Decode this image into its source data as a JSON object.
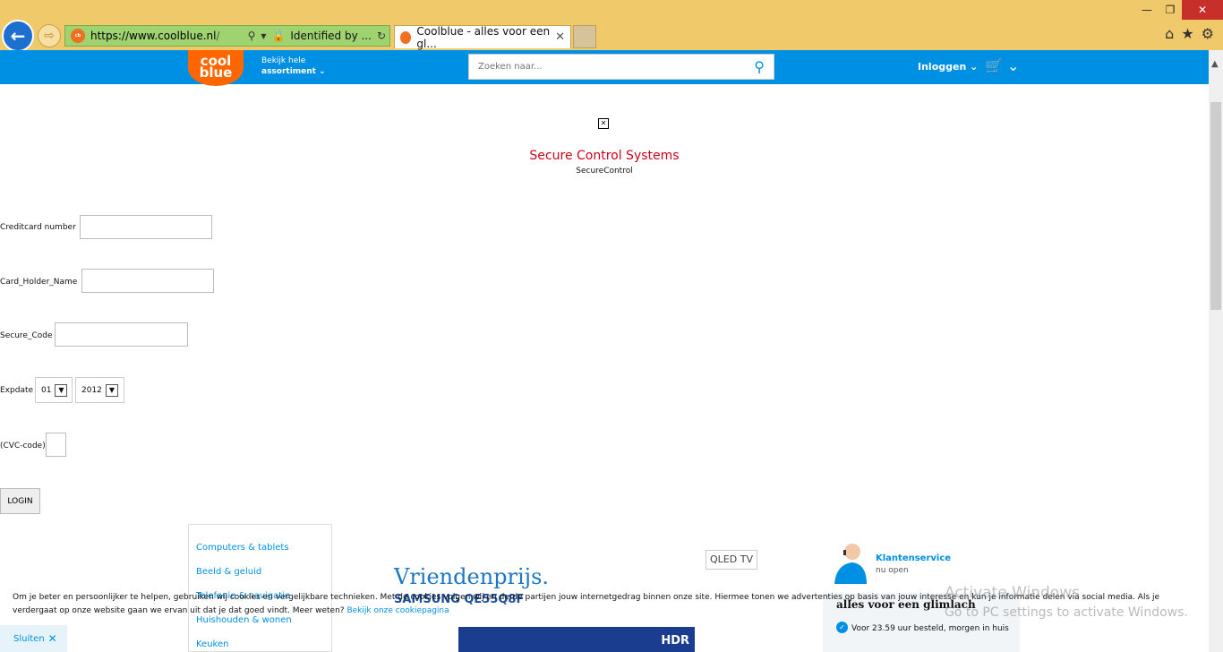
{
  "browser": {
    "url_main": "https://www.",
    "url_domain": "coolblue.nl",
    "url_rest": "/",
    "identified": "Identified by ...",
    "tab_title": "Coolblue - alles voor een gl...",
    "window_controls": {
      "minimize": "—",
      "maximize": "❐",
      "close": "✕"
    }
  },
  "site": {
    "logo_line1": "cool",
    "logo_line2": "blue",
    "assortment_line1": "Bekijk hele",
    "assortment_line2": "assortiment ⌄",
    "search_placeholder": "Zoeken naar...",
    "login": "Inloggen ⌄",
    "cart_caret": "⌄"
  },
  "form": {
    "title": "Secure Control Systems",
    "subtitle": "SecureControl",
    "cc_label": "Creditcard number",
    "holder_label": "Card_Holder_Name",
    "secure_label": "Secure_Code",
    "expdate_label": "Expdate",
    "month_value": "01",
    "year_value": "2012",
    "cvc_label": "(CVC-code)",
    "login_button": "LOGIN"
  },
  "categories": [
    "Computers & tablets",
    "Beeld & geluid",
    "Telefonie & navigatie",
    "Huishouden & wonen",
    "Keuken"
  ],
  "promo": {
    "headline": "Vriendenprijs.",
    "product": "SAMSUNG QE55Q8F",
    "hdr": "HDR",
    "qled": "QLED TV"
  },
  "service": {
    "title": "Klantenservice",
    "status": "nu open",
    "slogan": "alles voor een glimlach",
    "usp": "Voor 23.59 uur besteld, morgen in huis"
  },
  "cookie": {
    "text": "Om je beter en persoonlijker te helpen, gebruiken wij cookies en vergelijkbare technieken. Met de cookies volgen wij en derde partijen jouw internetgedrag binnen onze site. Hiermee tonen we advertenties op basis van jouw interesse en kun je informatie delen via social media. Als je verdergaat op onze website gaan we ervan uit dat je dat goed vindt. Meer weten? ",
    "link": "Bekijk onze cookiepagina",
    "close": "Sluiten"
  },
  "watermark": {
    "line1": "Activate Windows",
    "line2": "Go to PC settings to activate Windows."
  }
}
